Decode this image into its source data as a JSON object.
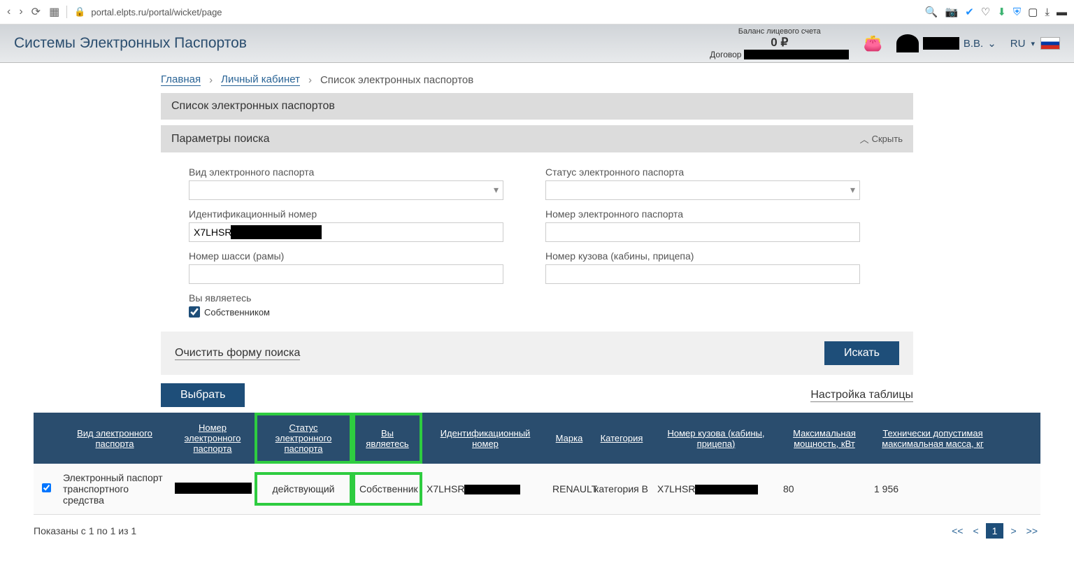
{
  "browser": {
    "url": "portal.elpts.ru/portal/wicket/page"
  },
  "header": {
    "title": "Системы Электронных Паспортов",
    "balance_label": "Баланс лицевого счета",
    "balance_value": "0 ₽",
    "contract_label": "Договор",
    "user_initials": "В.В.",
    "language": "RU"
  },
  "breadcrumb": {
    "home": "Главная",
    "account": "Личный кабинет",
    "current": "Список электронных паспортов"
  },
  "panel": {
    "title": "Список электронных паспортов",
    "search_title": "Параметры поиска",
    "toggle_label": "Скрыть"
  },
  "form": {
    "type_label": "Вид электронного паспорта",
    "status_label": "Статус электронного паспорта",
    "vin_label": "Идентификационный номер",
    "vin_value": "X7LHSR",
    "epts_num_label": "Номер электронного паспорта",
    "chassis_label": "Номер шасси (рамы)",
    "body_label": "Номер кузова (кабины, прицепа)",
    "role_label": "Вы являетесь",
    "role_checkbox": "Собственником",
    "clear": "Очистить форму поиска",
    "search": "Искать"
  },
  "actions": {
    "select": "Выбрать",
    "table_settings": "Настройка таблицы"
  },
  "columns": {
    "c1": "Вид электронного паспорта",
    "c2": "Номер электронного паспорта",
    "c3": "Статус электронного паспорта",
    "c4": "Вы являетесь",
    "c5": "Идентификационный номер",
    "c6": "Марка",
    "c7": "Категория",
    "c8": "Номер кузова (кабины, прицепа)",
    "c9": "Максимальная мощность, кВт",
    "c10": "Технически допустимая максимальная масса, кг"
  },
  "row": {
    "c1": "Электронный паспорт транспортного средства",
    "c3": "действующий",
    "c4": "Собственник",
    "c5": "X7LHSR",
    "c6": "RENAULT",
    "c7": "категория B",
    "c8": "X7LHSR",
    "c9": "80",
    "c10": "1 956"
  },
  "footer": {
    "summary": "Показаны с 1 по 1 из 1",
    "first": "<<",
    "prev": "<",
    "page": "1",
    "next": ">",
    "last": ">>"
  }
}
